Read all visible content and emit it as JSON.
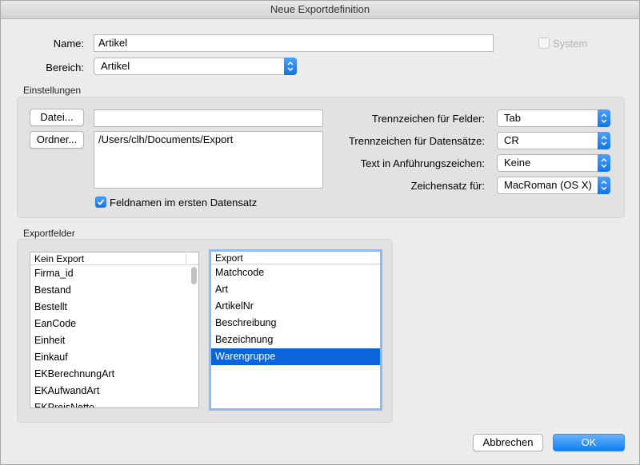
{
  "window": {
    "title": "Neue Exportdefinition"
  },
  "form": {
    "name_label": "Name:",
    "name_value": "Artikel",
    "system_label": "System",
    "bereich_label": "Bereich:",
    "bereich_value": "Artikel"
  },
  "einstellungen": {
    "title": "Einstellungen",
    "datei_button": "Datei...",
    "datei_value": "",
    "ordner_button": "Ordner...",
    "ordner_value": "/Users/clh/Documents/Export",
    "feldnamen_label": "Feldnamen im ersten Datensatz",
    "feldnamen_checked": true,
    "options": [
      {
        "label": "Trennzeichen für Felder:",
        "value": "Tab"
      },
      {
        "label": "Trennzeichen für Datensätze:",
        "value": "CR"
      },
      {
        "label": "Text in Anführungszeichen:",
        "value": "Keine"
      },
      {
        "label": "Zeichensatz für:",
        "value": "MacRoman (OS X)"
      }
    ]
  },
  "exportfelder": {
    "title": "Exportfelder",
    "kein_export_header": "Kein Export",
    "kein_export_items": [
      "Firma_id",
      "Bestand",
      "Bestellt",
      "EanCode",
      "Einheit",
      "Einkauf",
      "EKBerechnungArt",
      "EKAufwandArt",
      "EKPreisNetto"
    ],
    "export_header": "Export",
    "export_items": [
      "Matchcode",
      "Art",
      "ArtikelNr",
      "Beschreibung",
      "Bezeichnung",
      "Warengruppe"
    ],
    "export_selected": "Warengruppe"
  },
  "buttons": {
    "cancel": "Abbrechen",
    "ok": "OK"
  },
  "colors": {
    "accent": "#1473e6",
    "selection": "#0b64d8",
    "focus_ring": "#8fb9ef"
  }
}
